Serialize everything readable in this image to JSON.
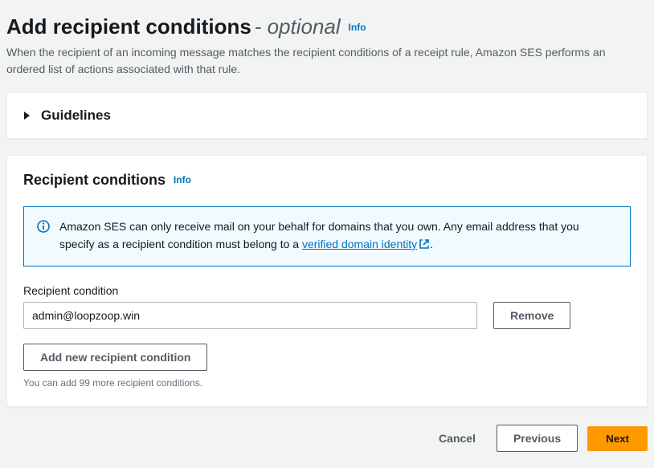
{
  "header": {
    "title": "Add recipient conditions",
    "separator": " - ",
    "optional": "optional",
    "info": "Info",
    "description": "When the recipient of an incoming message matches the recipient conditions of a receipt rule, Amazon SES performs an ordered list of actions associated with that rule."
  },
  "guidelines": {
    "title": "Guidelines"
  },
  "section": {
    "title": "Recipient conditions",
    "info": "Info",
    "infobox": {
      "text_before": "Amazon SES can only receive mail on your behalf for domains that you own. Any email address that you specify as a recipient condition must belong to a ",
      "link": "verified domain identity",
      "text_after": "."
    },
    "field_label": "Recipient condition",
    "recipients": [
      {
        "value": "admin@loopzoop.win"
      }
    ],
    "remove_label": "Remove",
    "add_label": "Add new recipient condition",
    "hint": "You can add 99 more recipient conditions."
  },
  "footer": {
    "cancel": "Cancel",
    "previous": "Previous",
    "next": "Next"
  }
}
